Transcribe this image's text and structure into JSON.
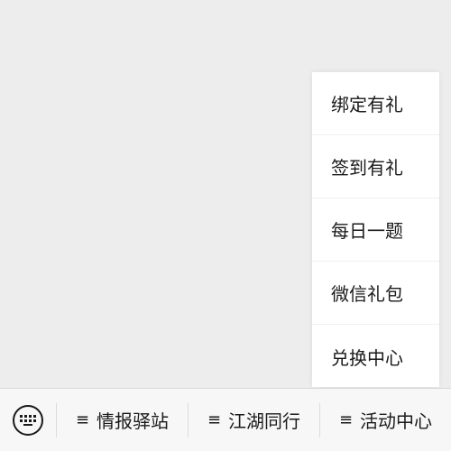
{
  "popup_menu": {
    "items": [
      {
        "label": "绑定有礼"
      },
      {
        "label": "签到有礼"
      },
      {
        "label": "每日一题"
      },
      {
        "label": "微信礼包"
      },
      {
        "label": "兑换中心"
      }
    ]
  },
  "bottom_bar": {
    "keyboard_icon": "keyboard-icon",
    "menu_icon": "≡",
    "menus": [
      {
        "label": "情报驿站"
      },
      {
        "label": "江湖同行"
      },
      {
        "label": "活动中心"
      }
    ]
  }
}
